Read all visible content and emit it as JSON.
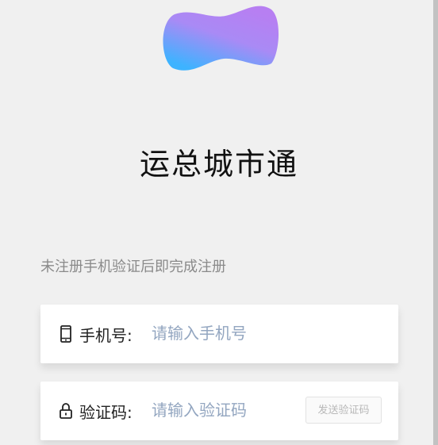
{
  "app": {
    "title": "运总城市通"
  },
  "logo": {
    "icon": "blob-logo",
    "gradient_start": "#c07ff0",
    "gradient_end": "#3fb3ff"
  },
  "form": {
    "hint": "未注册手机验证后即完成注册",
    "phone": {
      "icon": "phone-icon",
      "label": "手机号:",
      "placeholder": "请输入手机号",
      "value": ""
    },
    "code": {
      "icon": "lock-icon",
      "label": "验证码:",
      "placeholder": "请输入验证码",
      "value": "",
      "send_label": "发送验证码"
    }
  }
}
